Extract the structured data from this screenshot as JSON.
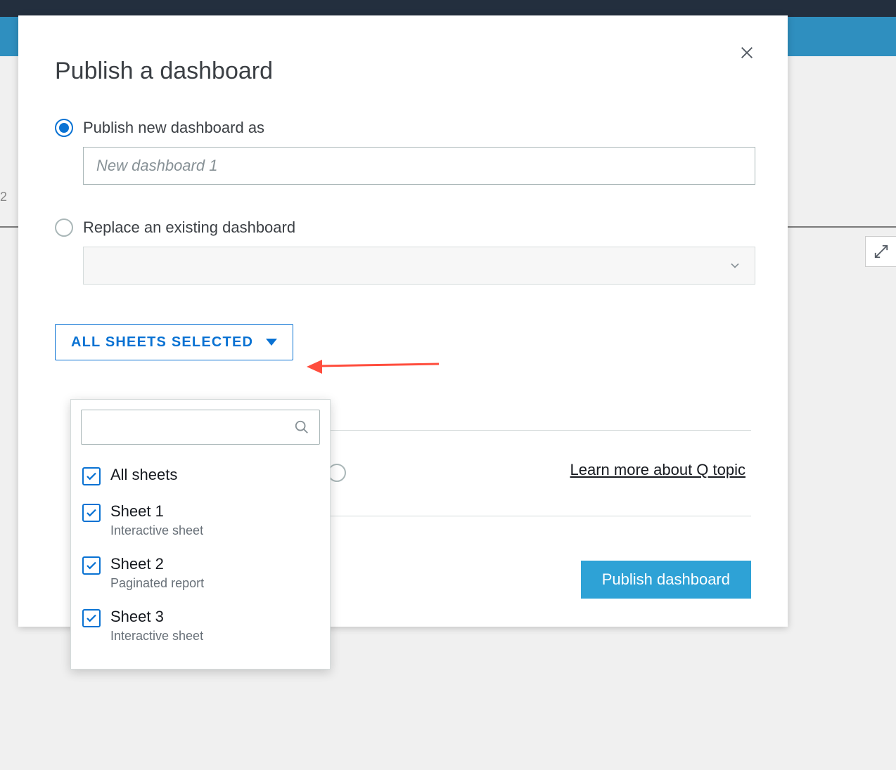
{
  "modal": {
    "title": "Publish a dashboard",
    "publish_new_label": "Publish new dashboard as",
    "publish_new_placeholder": "New dashboard 1",
    "replace_label": "Replace an existing dashboard",
    "sheets_button_label": "ALL SHEETS SELECTED",
    "q_link": "Learn more about Q topic",
    "publish_button": "Publish dashboard"
  },
  "sheets": {
    "all_label": "All sheets",
    "items": [
      {
        "name": "Sheet 1",
        "subtitle": "Interactive sheet"
      },
      {
        "name": "Sheet 2",
        "subtitle": "Paginated report"
      },
      {
        "name": "Sheet 3",
        "subtitle": "Interactive sheet"
      }
    ]
  }
}
